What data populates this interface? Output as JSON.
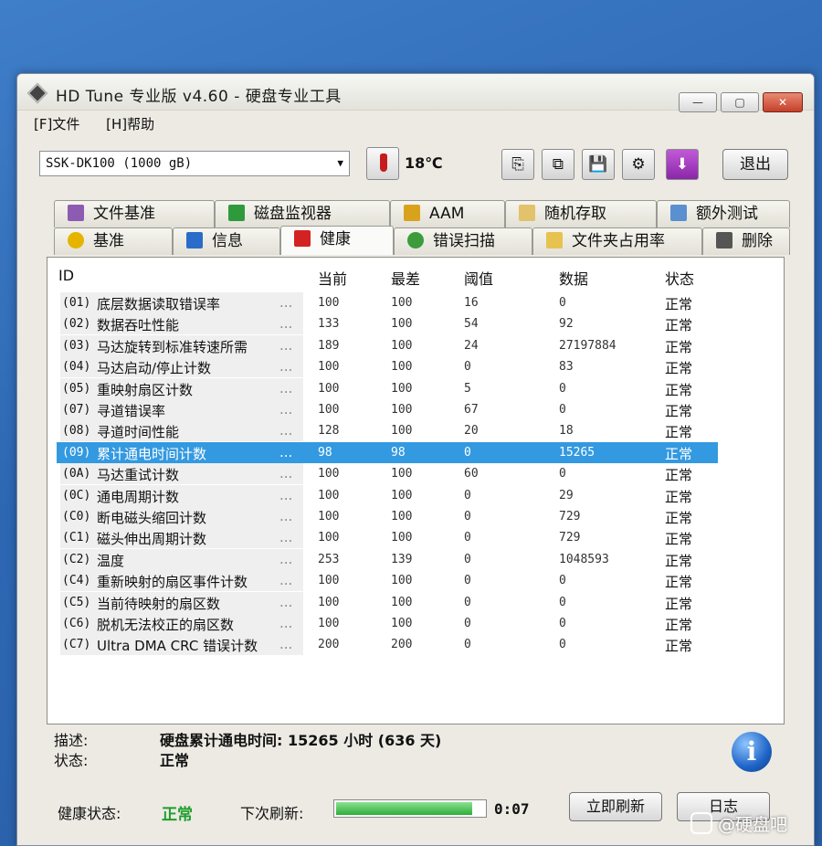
{
  "window": {
    "title": "HD Tune 专业版 v4.60 - 硬盘专业工具",
    "controls": {
      "minimize": "—",
      "maximize": "▢",
      "close": "✕"
    }
  },
  "menu": [
    "[F]文件",
    "[H]帮助"
  ],
  "toolbar": {
    "drive": "SSK-DK100 (1000 gB)",
    "temperature": "18℃",
    "exit_label": "退出"
  },
  "tabs_top": [
    "文件基准",
    "磁盘监视器",
    "AAM",
    "随机存取",
    "额外测试"
  ],
  "tabs_bottom": [
    "基准",
    "信息",
    "健康",
    "错误扫描",
    "文件夹占用率",
    "删除"
  ],
  "table": {
    "headers": [
      "ID",
      "当前",
      "最差",
      "阈值",
      "数据",
      "状态"
    ],
    "rows": [
      {
        "id": "(01)",
        "name": "底层数据读取错误率",
        "dots": "...",
        "current": "100",
        "worst": "100",
        "threshold": "16",
        "data": "0",
        "status": "正常"
      },
      {
        "id": "(02)",
        "name": "数据吞吐性能",
        "dots": "...",
        "current": "133",
        "worst": "100",
        "threshold": "54",
        "data": "92",
        "status": "正常"
      },
      {
        "id": "(03)",
        "name": "马达旋转到标准转速所需",
        "dots": "...",
        "current": "189",
        "worst": "100",
        "threshold": "24",
        "data": "27197884",
        "status": "正常"
      },
      {
        "id": "(04)",
        "name": "马达启动/停止计数",
        "dots": "...",
        "current": "100",
        "worst": "100",
        "threshold": "0",
        "data": "83",
        "status": "正常"
      },
      {
        "id": "(05)",
        "name": "重映射扇区计数",
        "dots": "...",
        "current": "100",
        "worst": "100",
        "threshold": "5",
        "data": "0",
        "status": "正常"
      },
      {
        "id": "(07)",
        "name": "寻道错误率",
        "dots": "...",
        "current": "100",
        "worst": "100",
        "threshold": "67",
        "data": "0",
        "status": "正常"
      },
      {
        "id": "(08)",
        "name": "寻道时间性能",
        "dots": "...",
        "current": "128",
        "worst": "100",
        "threshold": "20",
        "data": "18",
        "status": "正常"
      },
      {
        "id": "(09)",
        "name": "累计通电时间计数",
        "dots": "...",
        "current": "98",
        "worst": "98",
        "threshold": "0",
        "data": "15265",
        "status": "正常"
      },
      {
        "id": "(0A)",
        "name": "马达重试计数",
        "dots": "...",
        "current": "100",
        "worst": "100",
        "threshold": "60",
        "data": "0",
        "status": "正常"
      },
      {
        "id": "(0C)",
        "name": "通电周期计数",
        "dots": "...",
        "current": "100",
        "worst": "100",
        "threshold": "0",
        "data": "29",
        "status": "正常"
      },
      {
        "id": "(C0)",
        "name": "断电磁头缩回计数",
        "dots": "...",
        "current": "100",
        "worst": "100",
        "threshold": "0",
        "data": "729",
        "status": "正常"
      },
      {
        "id": "(C1)",
        "name": "磁头伸出周期计数",
        "dots": "...",
        "current": "100",
        "worst": "100",
        "threshold": "0",
        "data": "729",
        "status": "正常"
      },
      {
        "id": "(C2)",
        "name": "温度",
        "dots": "...",
        "current": "253",
        "worst": "139",
        "threshold": "0",
        "data": "1048593",
        "status": "正常"
      },
      {
        "id": "(C4)",
        "name": "重新映射的扇区事件计数",
        "dots": "...",
        "current": "100",
        "worst": "100",
        "threshold": "0",
        "data": "0",
        "status": "正常"
      },
      {
        "id": "(C5)",
        "name": "当前待映射的扇区数",
        "dots": "...",
        "current": "100",
        "worst": "100",
        "threshold": "0",
        "data": "0",
        "status": "正常"
      },
      {
        "id": "(C6)",
        "name": "脱机无法校正的扇区数",
        "dots": "...",
        "current": "100",
        "worst": "100",
        "threshold": "0",
        "data": "0",
        "status": "正常"
      },
      {
        "id": "(C7)",
        "name": "Ultra DMA CRC 错误计数",
        "dots": "...",
        "current": "200",
        "worst": "200",
        "threshold": "0",
        "data": "0",
        "status": "正常"
      }
    ],
    "selected_index": 7
  },
  "details": {
    "desc_label": "描述:",
    "desc_value": "硬盘累计通电时间: 15265 小时 (636 天)",
    "status_label": "状态:",
    "status_value": "正常"
  },
  "status_bar": {
    "health_label": "健康状态:",
    "health_value": "正常",
    "refresh_label": "下次刷新:",
    "countdown": "0:07",
    "refresh_progress": 0.92,
    "refresh_button": "立即刷新",
    "log_button": "日志"
  },
  "watermark": "@硬盘吧",
  "colors": {
    "selection": "#3399e0",
    "health_ok": "#1f9e2c",
    "desktop": "#3a75c0"
  }
}
